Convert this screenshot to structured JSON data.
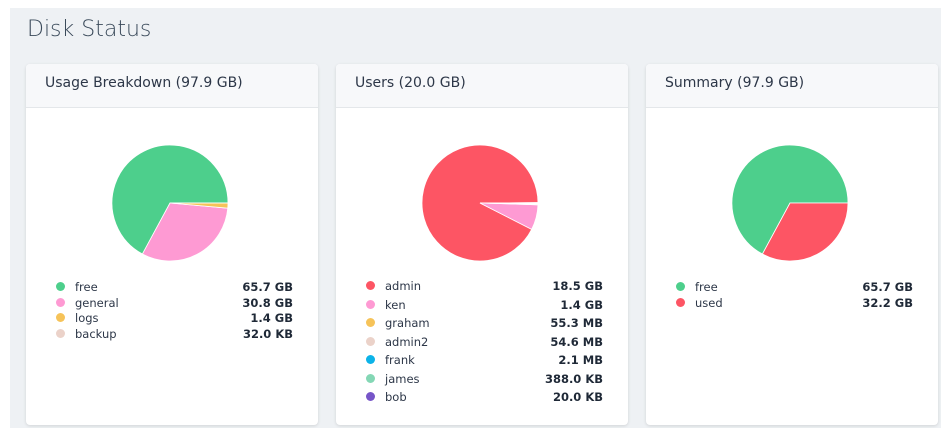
{
  "page": {
    "title": "Disk Status"
  },
  "colors": {
    "free": "#4dcf8c",
    "general": "#fe9ad3",
    "logs": "#f6c359",
    "backup": "#ebd2c9",
    "admin": "#fd5564",
    "ken": "#fe9ad3",
    "graham": "#f6c359",
    "admin2": "#ebd2c9",
    "frank": "#0cb3e8",
    "james": "#84d7b5",
    "bob": "#7655c8",
    "used": "#fd5564"
  },
  "cards": [
    {
      "title": "Usage Breakdown (97.9 GB)",
      "items": [
        {
          "label": "free",
          "value": "65.7 GB",
          "color": "#4dcf8c",
          "share": 0.6711
        },
        {
          "label": "general",
          "value": "30.8 GB",
          "color": "#fe9ad3",
          "share": 0.3146
        },
        {
          "label": "logs",
          "value": "1.4 GB",
          "color": "#f6c359",
          "share": 0.0143
        },
        {
          "label": "backup",
          "value": "32.0 KB",
          "color": "#ebd2c9",
          "share": 0.0003
        }
      ]
    },
    {
      "title": "Users (20.0 GB)",
      "items": [
        {
          "label": "admin",
          "value": "18.5 GB",
          "color": "#fd5564",
          "share": 0.925
        },
        {
          "label": "ken",
          "value": "1.4 GB",
          "color": "#fe9ad3",
          "share": 0.07
        },
        {
          "label": "graham",
          "value": "55.3 MB",
          "color": "#f6c359",
          "share": 0.0027
        },
        {
          "label": "admin2",
          "value": "54.6 MB",
          "color": "#ebd2c9",
          "share": 0.0027
        },
        {
          "label": "frank",
          "value": "2.1 MB",
          "color": "#0cb3e8",
          "share": 0.0001
        },
        {
          "label": "james",
          "value": "388.0 KB",
          "color": "#84d7b5",
          "share": 2e-05
        },
        {
          "label": "bob",
          "value": "20.0 KB",
          "color": "#7655c8",
          "share": 1e-06
        }
      ]
    },
    {
      "title": "Summary (97.9 GB)",
      "items": [
        {
          "label": "free",
          "value": "65.7 GB",
          "color": "#4dcf8c",
          "share": 0.6711
        },
        {
          "label": "used",
          "value": "32.2 GB",
          "color": "#fd5564",
          "share": 0.3289
        }
      ]
    }
  ]
}
